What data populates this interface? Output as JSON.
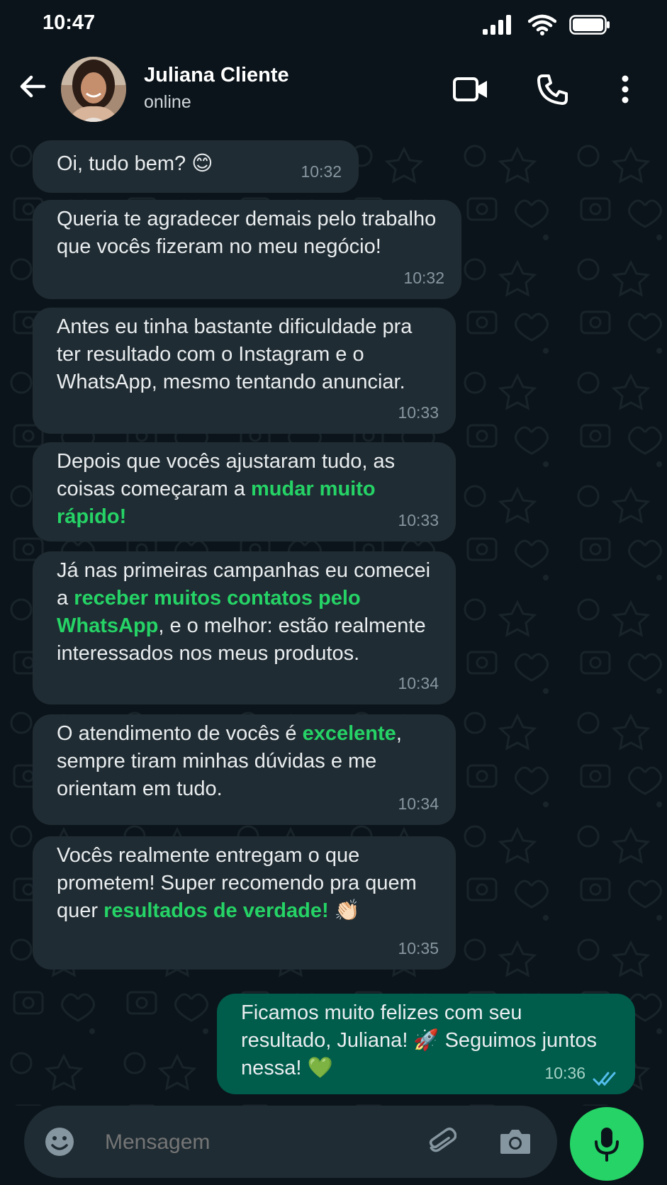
{
  "status_bar": {
    "time": "10:47"
  },
  "header": {
    "name": "Juliana Cliente",
    "status": "online"
  },
  "messages": [
    {
      "id": "m1",
      "parts": [
        {
          "t": "Oi, tudo bem? 😊",
          "hl": false
        }
      ],
      "time": "10:32"
    },
    {
      "id": "m2",
      "parts": [
        {
          "t": "Queria te agradecer demais pelo trabalho que vocês fizeram no meu negócio!",
          "hl": false
        }
      ],
      "time": "10:32"
    },
    {
      "id": "m3",
      "parts": [
        {
          "t": "Antes eu tinha bastante dificuldade pra ter resultado com o Instagram e o WhatsApp, mesmo tentando anunciar.",
          "hl": false
        }
      ],
      "time": "10:33"
    },
    {
      "id": "m4",
      "parts": [
        {
          "t": "Depois que vocês ajustaram tudo, as coisas começaram a ",
          "hl": false
        },
        {
          "t": "mudar muito rápido!",
          "hl": true
        }
      ],
      "time": "10:33"
    },
    {
      "id": "m5",
      "parts": [
        {
          "t": "Já nas primeiras campanhas eu comecei a ",
          "hl": false
        },
        {
          "t": "receber muitos contatos pelo WhatsApp",
          "hl": true
        },
        {
          "t": ", e o melhor: estão realmente interessados nos meus produtos.",
          "hl": false
        }
      ],
      "time": "10:34"
    },
    {
      "id": "m6",
      "parts": [
        {
          "t": "O atendimento de vocês é ",
          "hl": false
        },
        {
          "t": "excelente",
          "hl": true
        },
        {
          "t": ", sempre tiram minhas dúvidas e me orientam em tudo.",
          "hl": false
        }
      ],
      "time": "10:34"
    },
    {
      "id": "m7",
      "parts": [
        {
          "t": "Vocês realmente entregam o que prometem! Super recomendo pra quem quer ",
          "hl": false
        },
        {
          "t": "resultados de verdade!",
          "hl": true
        },
        {
          "t": " 👏🏻",
          "hl": false
        }
      ],
      "time": "10:35"
    },
    {
      "id": "m8",
      "parts": [
        {
          "t": "Ficamos muito felizes com seu resultado, Juliana! 🚀 Seguimos juntos nessa! 💚",
          "hl": false
        }
      ],
      "time": "10:36",
      "outgoing": true
    }
  ],
  "composer": {
    "placeholder": "Mensagem"
  },
  "colors": {
    "accent": "#25d366",
    "incoming_bubble": "#202c33",
    "outgoing_bubble": "#005c4b",
    "read_ticks": "#53bdeb"
  }
}
